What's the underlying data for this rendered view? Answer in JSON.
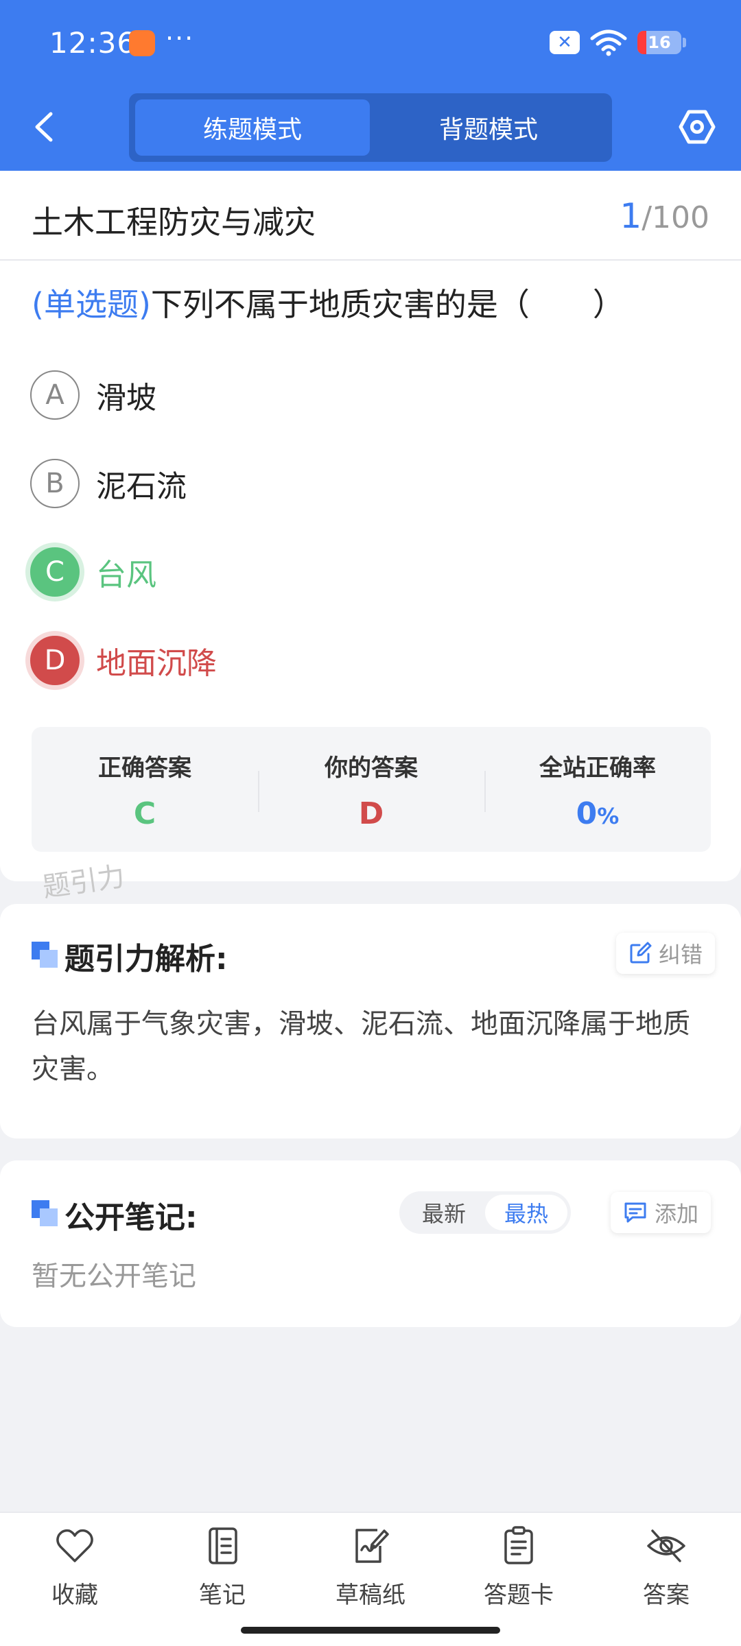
{
  "status_bar": {
    "time": "12:36",
    "dots": "···",
    "battery_level": "16",
    "battery_percent": 16
  },
  "header": {
    "modes": [
      "练题模式",
      "背题模式"
    ],
    "active_mode": "练题模式"
  },
  "subject": {
    "title": "土木工程防灾与减灾",
    "current": "1",
    "total": "/100"
  },
  "question": {
    "type": "(单选题)",
    "text": "下列不属于地质灾害的是（　　）",
    "options": [
      {
        "letter": "A",
        "text": "滑坡",
        "state": "normal"
      },
      {
        "letter": "B",
        "text": "泥石流",
        "state": "normal"
      },
      {
        "letter": "C",
        "text": "台风",
        "state": "correct"
      },
      {
        "letter": "D",
        "text": "地面沉降",
        "state": "wrong"
      }
    ]
  },
  "result": {
    "correct_label": "正确答案",
    "correct_value": "C",
    "yours_label": "你的答案",
    "yours_value": "D",
    "rate_label": "全站正确率",
    "rate_value": "0",
    "rate_unit": "%"
  },
  "watermark": "题引力",
  "analysis": {
    "title": "题引力解析:",
    "report_label": "纠错",
    "text": "台风属于气象灾害，滑坡、泥石流、地面沉降属于地质灾害。"
  },
  "notes": {
    "title": "公开笔记:",
    "sort_options": [
      "最新",
      "最热"
    ],
    "active_sort": "最热",
    "add_label": "添加",
    "empty_text": "暂无公开笔记"
  },
  "bottom_nav": [
    {
      "label": "收藏",
      "icon": "heart-icon"
    },
    {
      "label": "笔记",
      "icon": "notebook-icon"
    },
    {
      "label": "草稿纸",
      "icon": "draft-paper-icon"
    },
    {
      "label": "答题卡",
      "icon": "answer-sheet-icon"
    },
    {
      "label": "答案",
      "icon": "eye-off-icon"
    }
  ],
  "colors": {
    "primary": "#3d7cf0",
    "correct": "#5ac47f",
    "wrong": "#d14b4b"
  }
}
